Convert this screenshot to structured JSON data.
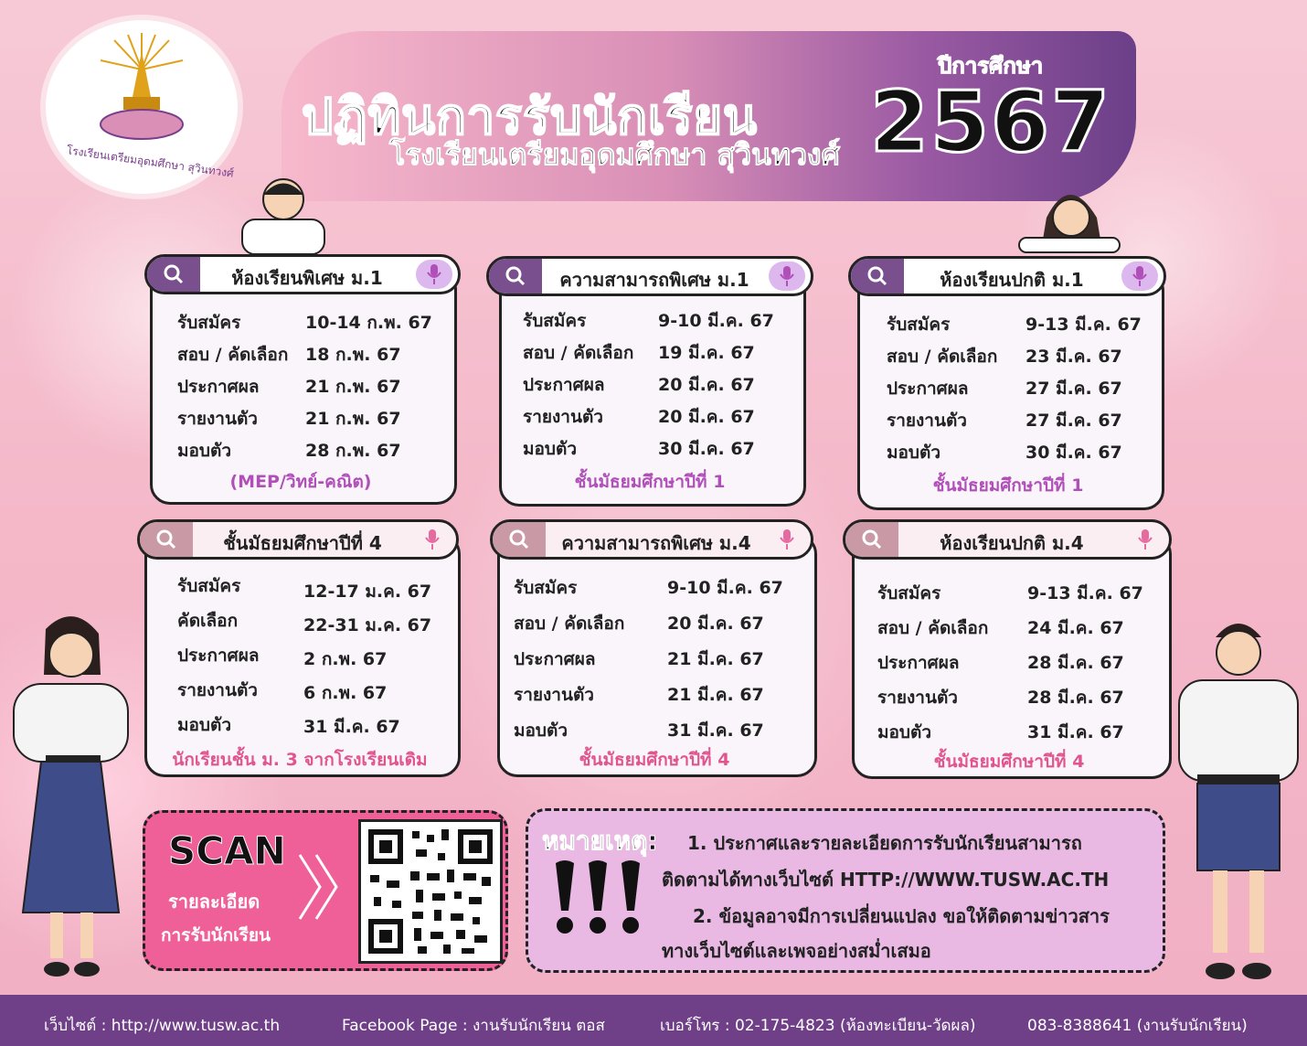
{
  "logo": {
    "text": "โรงเรียนเตรียมอุดมศึกษา สุวินทวงศ์"
  },
  "header": {
    "title": "ปฏิทินการรับนักเรียน",
    "subtitle": "โรงเรียนเตรียมอุดมศึกษา สุวินทวงศ์",
    "year_label": "ปีการศึกษา",
    "year": "2567"
  },
  "cards": [
    {
      "title": "ห้องเรียนพิเศษ ม.1",
      "rows": [
        [
          "รับสมัคร",
          "10-14 ก.พ. 67"
        ],
        [
          "สอบ / คัดเลือก",
          "18 ก.พ. 67"
        ],
        [
          "ประกาศผล",
          "21 ก.พ. 67"
        ],
        [
          "รายงานตัว",
          "21 ก.พ. 67"
        ],
        [
          "มอบตัว",
          "28 ก.พ. 67"
        ]
      ],
      "footer": "(MEP/วิทย์-คณิต)"
    },
    {
      "title": "ความสามารถพิเศษ ม.1",
      "rows": [
        [
          "รับสมัคร",
          "9-10 มี.ค. 67"
        ],
        [
          "สอบ / คัดเลือก",
          "19 มี.ค. 67"
        ],
        [
          "ประกาศผล",
          "20 มี.ค. 67"
        ],
        [
          "รายงานตัว",
          "20 มี.ค. 67"
        ],
        [
          "มอบตัว",
          "30 มี.ค. 67"
        ]
      ],
      "footer": "ชั้นมัธยมศึกษาปีที่ 1"
    },
    {
      "title": "ห้องเรียนปกติ ม.1",
      "rows": [
        [
          "รับสมัคร",
          "9-13 มี.ค. 67"
        ],
        [
          "สอบ / คัดเลือก",
          "23 มี.ค. 67"
        ],
        [
          "ประกาศผล",
          "27 มี.ค. 67"
        ],
        [
          "รายงานตัว",
          "27 มี.ค. 67"
        ],
        [
          "มอบตัว",
          "30 มี.ค. 67"
        ]
      ],
      "footer": "ชั้นมัธยมศึกษาปีที่ 1"
    },
    {
      "title": "ชั้นมัธยมศึกษาปีที่ 4",
      "rows": [
        [
          "รับสมัคร",
          "12-17 ม.ค. 67"
        ],
        [
          "คัดเลือก",
          "22-31 ม.ค. 67"
        ],
        [
          "ประกาศผล",
          "2 ก.พ. 67"
        ],
        [
          "รายงานตัว",
          "6 ก.พ. 67"
        ],
        [
          "มอบตัว",
          "31 มี.ค. 67"
        ]
      ],
      "footer": "นักเรียนชั้น ม. 3 จากโรงเรียนเดิม"
    },
    {
      "title": "ความสามารถพิเศษ ม.4",
      "rows": [
        [
          "รับสมัคร",
          "9-10 มี.ค. 67"
        ],
        [
          "สอบ / คัดเลือก",
          "20 มี.ค. 67"
        ],
        [
          "ประกาศผล",
          "21 มี.ค. 67"
        ],
        [
          "รายงานตัว",
          "21 มี.ค. 67"
        ],
        [
          "มอบตัว",
          "31 มี.ค. 67"
        ]
      ],
      "footer": "ชั้นมัธยมศึกษาปีที่ 4"
    },
    {
      "title": "ห้องเรียนปกติ ม.4",
      "rows": [
        [
          "รับสมัคร",
          "9-13 มี.ค. 67"
        ],
        [
          "สอบ / คัดเลือก",
          "24 มี.ค. 67"
        ],
        [
          "ประกาศผล",
          "28 มี.ค. 67"
        ],
        [
          "รายงานตัว",
          "28 มี.ค. 67"
        ],
        [
          "มอบตัว",
          "31 มี.ค. 67"
        ]
      ],
      "footer": "ชั้นมัธยมศึกษาปีที่ 4"
    }
  ],
  "scan": {
    "word": "SCAN",
    "line1": "รายละเอียด",
    "line2": "การรับนักเรียน"
  },
  "note": {
    "title": "หมายเหตุ:",
    "line1": "1. ประกาศและรายละเอียดการรับนักเรียนสามารถ",
    "line2": "ติดตามได้ทางเว็บไซต์ HTTP://WWW.TUSW.AC.TH",
    "line3": "2. ข้อมูลอาจมีการเปลี่ยนแปลง ขอให้ติดตามข่าวสาร",
    "line4": "ทางเว็บไซต์และเพจอย่างสม่ำเสมอ"
  },
  "footer": {
    "website": "เว็บไซต์ : http://www.tusw.ac.th",
    "facebook": "Facebook Page : งานรับนักเรียน ตอส",
    "phone1": "เบอร์โทร : 02-175-4823 (ห้องทะเบียน-วัดผล)",
    "phone2": "083-8388641 (งานรับนักเรียน)"
  },
  "colors": {
    "accent_purple": "#6f3f88",
    "accent_pink": "#ef5f98",
    "footer_text": "#b04fb8"
  }
}
